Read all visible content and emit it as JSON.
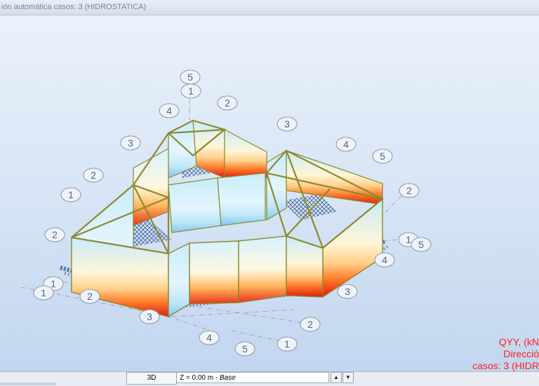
{
  "window": {
    "title": "ión automática casos: 3 (HIDROSTATICA)"
  },
  "legend": {
    "line1": "QYY, (kN",
    "line2": "Direcció",
    "line3": "casos: 3 (HIDR"
  },
  "statusbar": {
    "view_mode": "3D",
    "level_prefix": "Z = 0.00 m - ",
    "level_name": "Base",
    "up_glyph": "▲",
    "down_glyph": "▼"
  },
  "grid_labels": [
    "5",
    "1",
    "4",
    "2",
    "3",
    "3",
    "4",
    "5",
    "2",
    "2",
    "1",
    "2",
    "1",
    "5",
    "4",
    "3",
    "1",
    "1",
    "2",
    "3",
    "2",
    "4",
    "5",
    "1"
  ],
  "icons": {
    "support": "fixed-support-icon",
    "up": "arrow-up-icon",
    "down": "arrow-down-icon"
  },
  "colors": {
    "background": "#dbe6f6",
    "legend": "#ff1f1f",
    "frame": "#8c8a2e",
    "grid_line": "#8c96a8"
  }
}
